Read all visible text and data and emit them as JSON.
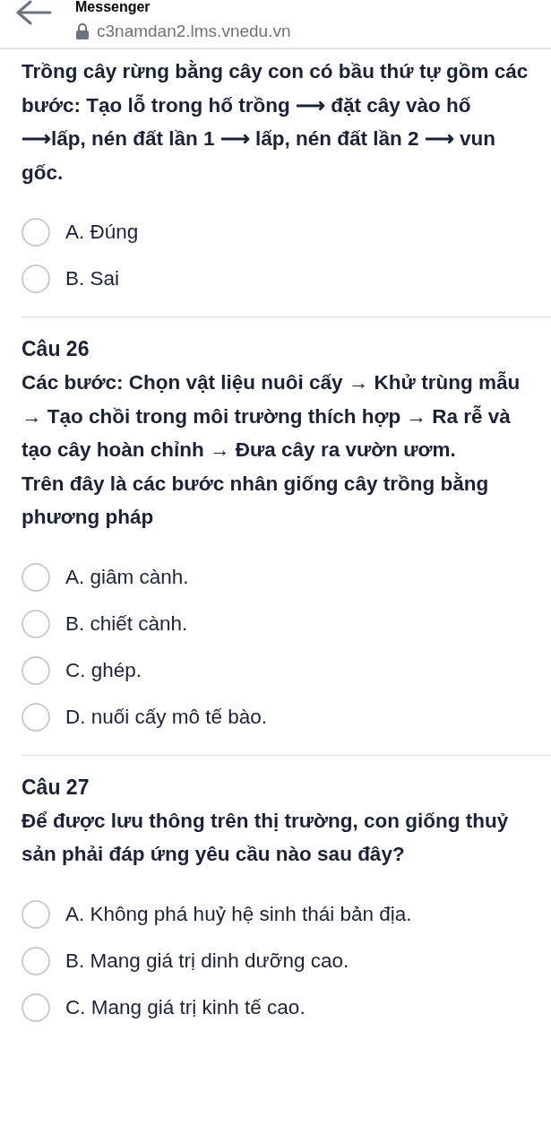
{
  "header": {
    "title": "Messenger",
    "url": "c3namdan2.lms.vnedu.vn"
  },
  "questions": [
    {
      "paragraphs": [
        "Trồng cây rừng bằng cây con có bầu thứ tự gồm các bước: Tạo lỗ trong hố trồng ⟶ đặt cây vào hố ⟶lấp, nén đất lần 1 ⟶ lấp, nén đất lần 2 ⟶ vun gốc."
      ],
      "options": [
        {
          "label": "A.",
          "text": "Đúng",
          "selected": false
        },
        {
          "label": "B.",
          "text": "Sai",
          "selected": false
        }
      ]
    },
    {
      "number": "Câu 26",
      "paragraphs": [
        "Các bước: Chọn vật liệu nuôi cấy → Khử trùng mẫu → Tạo chồi trong môi trường thích hợp → Ra rễ và tạo cây hoàn chỉnh → Đưa cây ra vườn ươm.",
        "Trên đây là các bước nhân giống cây trồng bằng phương pháp"
      ],
      "options": [
        {
          "label": "A.",
          "text": "giâm cành.",
          "selected": false
        },
        {
          "label": "B.",
          "text": "chiết cành.",
          "selected": false
        },
        {
          "label": "C.",
          "text": "ghép.",
          "selected": false
        },
        {
          "label": "D.",
          "text": "nuối cấy mô tế bào.",
          "selected": false
        }
      ]
    },
    {
      "number": "Câu 27",
      "paragraphs": [
        "Để được lưu thông trên thị trường, con giống thuỷ sản phải đáp ứng yêu cầu nào sau đây?"
      ],
      "options": [
        {
          "label": "A.",
          "text": "Không phá huỷ hệ sinh thái bản địa.",
          "selected": false
        },
        {
          "label": "B.",
          "text": "Mang giá trị dinh dưỡng cao.",
          "selected": false
        },
        {
          "label": "C.",
          "text": "Mang giá trị kinh tế cao.",
          "selected": false
        }
      ]
    }
  ]
}
